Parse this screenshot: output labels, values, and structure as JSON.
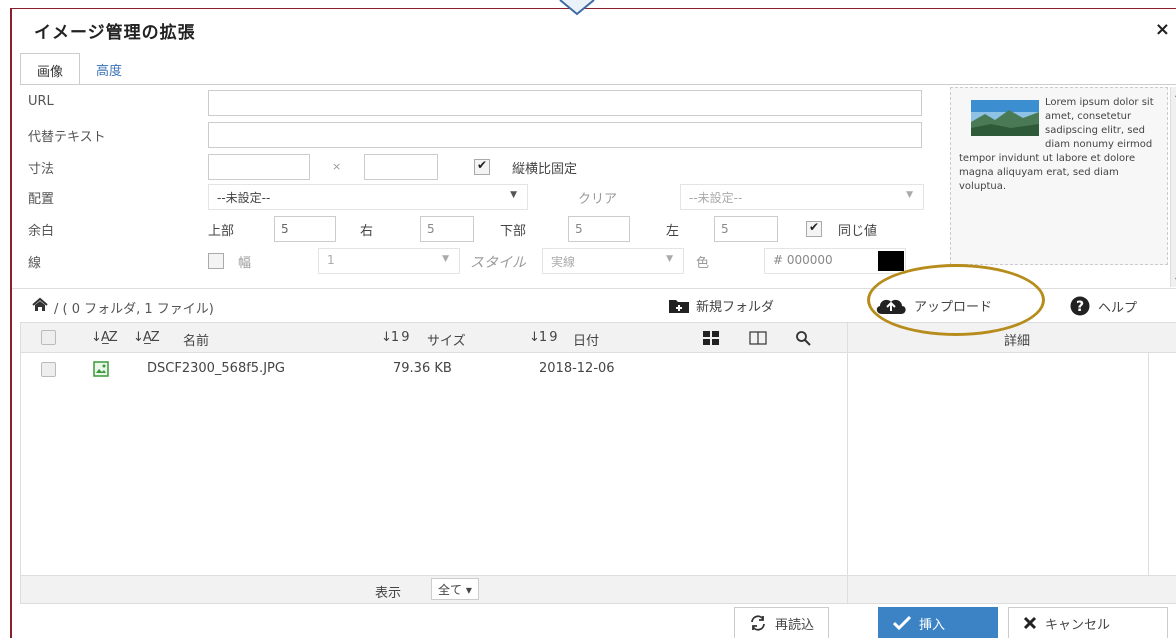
{
  "dialog": {
    "title": "イメージ管理の拡張",
    "close_label": "×"
  },
  "tabs": [
    {
      "label": "画像",
      "active": true
    },
    {
      "label": "高度",
      "active": false
    }
  ],
  "form": {
    "url_label": "URL",
    "url_value": "",
    "alt_label": "代替テキスト",
    "alt_value": "",
    "size_label": "寸法",
    "width_value": "",
    "size_separator": "×",
    "height_value": "",
    "lock_ratio_label": "縦横比固定",
    "lock_ratio_checked": true,
    "align_label": "配置",
    "align_value": "--未設定--",
    "clear_label": "クリア",
    "clear_value": "--未設定--",
    "margin_label": "余白",
    "margin_top_label": "上部",
    "margin_top_value": "5",
    "margin_right_label": "右",
    "margin_right_value": "5",
    "margin_bottom_label": "下部",
    "margin_bottom_value": "5",
    "margin_left_label": "左",
    "margin_left_value": "5",
    "same_value_label": "同じ値",
    "same_value_checked": true,
    "border_label": "線",
    "border_width_label": "幅",
    "border_width_value": "1",
    "border_style_label": "スタイル",
    "border_style_value": "実線",
    "border_color_label": "色",
    "border_color_value": "# 000000",
    "border_color_swatch": "#000000"
  },
  "preview": {
    "text": "Lorem ipsum dolor sit amet, consetetur sadipscing elitr, sed diam nonumy eirmod tempor invidunt ut labore et dolore magna aliquyam erat, sed diam voluptua."
  },
  "browser": {
    "path": "/ ( 0 フォルダ, 1 ファイル)",
    "new_folder_label": "新規フォルダ",
    "upload_label": "アップロード",
    "help_label": "ヘルプ",
    "columns": {
      "name": "名前",
      "size": "サイズ",
      "date": "日付"
    },
    "detail_title": "詳細",
    "files": [
      {
        "name": "DSCF2300_568f5.JPG",
        "size": "79.36 KB",
        "date": "2018-12-06"
      }
    ],
    "show_label": "表示",
    "show_value": "全て ▾"
  },
  "buttons": {
    "reload": "再読込",
    "insert": "挿入",
    "cancel": "キャンセル"
  },
  "colors": {
    "accent": "#3c83c5",
    "dialog_border": "#8b1f2e",
    "highlight_ring": "#b68c1c"
  }
}
